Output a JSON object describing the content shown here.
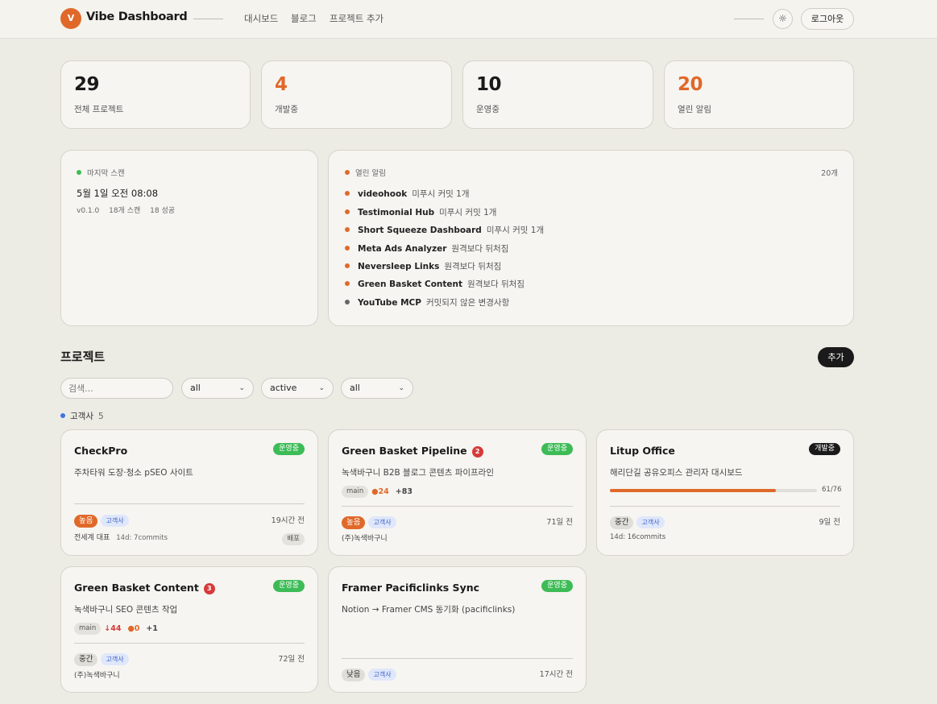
{
  "header": {
    "logo_letter": "V",
    "title": "Vibe Dashboard",
    "nav": [
      "대시보드",
      "블로그",
      "프로젝트 추가"
    ],
    "theme_icon": "sun-icon",
    "logout_label": "로그아웃"
  },
  "stats": [
    {
      "value": "29",
      "label": "전체 프로젝트",
      "accent": false
    },
    {
      "value": "4",
      "label": "개발중",
      "accent": true
    },
    {
      "value": "10",
      "label": "운영중",
      "accent": false
    },
    {
      "value": "20",
      "label": "열린 알림",
      "accent": true
    }
  ],
  "scan": {
    "title": "마지막 스캔",
    "datetime": "5월 1일 오전 08:08",
    "version": "v0.1.0",
    "scans": "18개 스캔",
    "success": "18 성공"
  },
  "alerts": {
    "title": "열린 알림",
    "count": "20개",
    "items": [
      {
        "name": "videohook",
        "desc": "미푸시 커밋 1개"
      },
      {
        "name": "Testimonial Hub",
        "desc": "미푸시 커밋 1개"
      },
      {
        "name": "Short Squeeze Dashboard",
        "desc": "미푸시 커밋 1개"
      },
      {
        "name": "Meta Ads Analyzer",
        "desc": "원격보다 뒤처짐"
      },
      {
        "name": "Neversleep Links",
        "desc": "원격보다 뒤처짐"
      },
      {
        "name": "Green Basket Content",
        "desc": "원격보다 뒤처짐"
      },
      {
        "name": "YouTube MCP",
        "desc": "커밋되지 않은 변경사항"
      }
    ]
  },
  "projects_section": {
    "title": "프로젝트",
    "add_label": "추가",
    "search_placeholder": "검색...",
    "filters": [
      "all",
      "active",
      "all"
    ],
    "group": {
      "label": "고객사",
      "count": "5"
    }
  },
  "projects": [
    {
      "name": "CheckPro",
      "status": "운영중",
      "desc": "주차타워 도장·청소 pSEO 사이트",
      "priority": "높음",
      "client_tag": "고객사",
      "time": "19시간 전",
      "owner": "전세계 대표",
      "commits": "14d: 7commits",
      "deploy_tag": "배포"
    },
    {
      "name": "Green Basket Pipeline",
      "badge": "2",
      "status": "운영중",
      "desc": "녹색바구니 B2B 블로그 콘텐츠 파이프라인",
      "branch": "main",
      "ahead": "●24",
      "plus": "+83",
      "priority": "높음",
      "client_tag": "고객사",
      "time": "71일 전",
      "owner": "(주)녹색바구니"
    },
    {
      "name": "Litup Office",
      "status": "개발중",
      "desc": "해리단길 공유오피스 관리자 대시보드",
      "progress": 0.803,
      "progress_label": "61/76",
      "priority": "중간",
      "client_tag": "고객사",
      "time": "9일 전",
      "commits": "14d: 16commits"
    },
    {
      "name": "Green Basket Content",
      "badge": "3",
      "status": "운영중",
      "desc": "녹색바구니 SEO 콘텐츠 작업",
      "branch": "main",
      "behind": "↓44",
      "ahead": "●0",
      "plus": "+1",
      "priority": "중간",
      "client_tag": "고객사",
      "time": "72일 전",
      "owner": "(주)녹색바구니"
    },
    {
      "name": "Framer Pacificlinks Sync",
      "status": "운영중",
      "desc": "Notion → Framer CMS 동기화 (pacificlinks)",
      "priority": "낮음",
      "client_tag": "고객사",
      "time": "17시간 전"
    }
  ]
}
